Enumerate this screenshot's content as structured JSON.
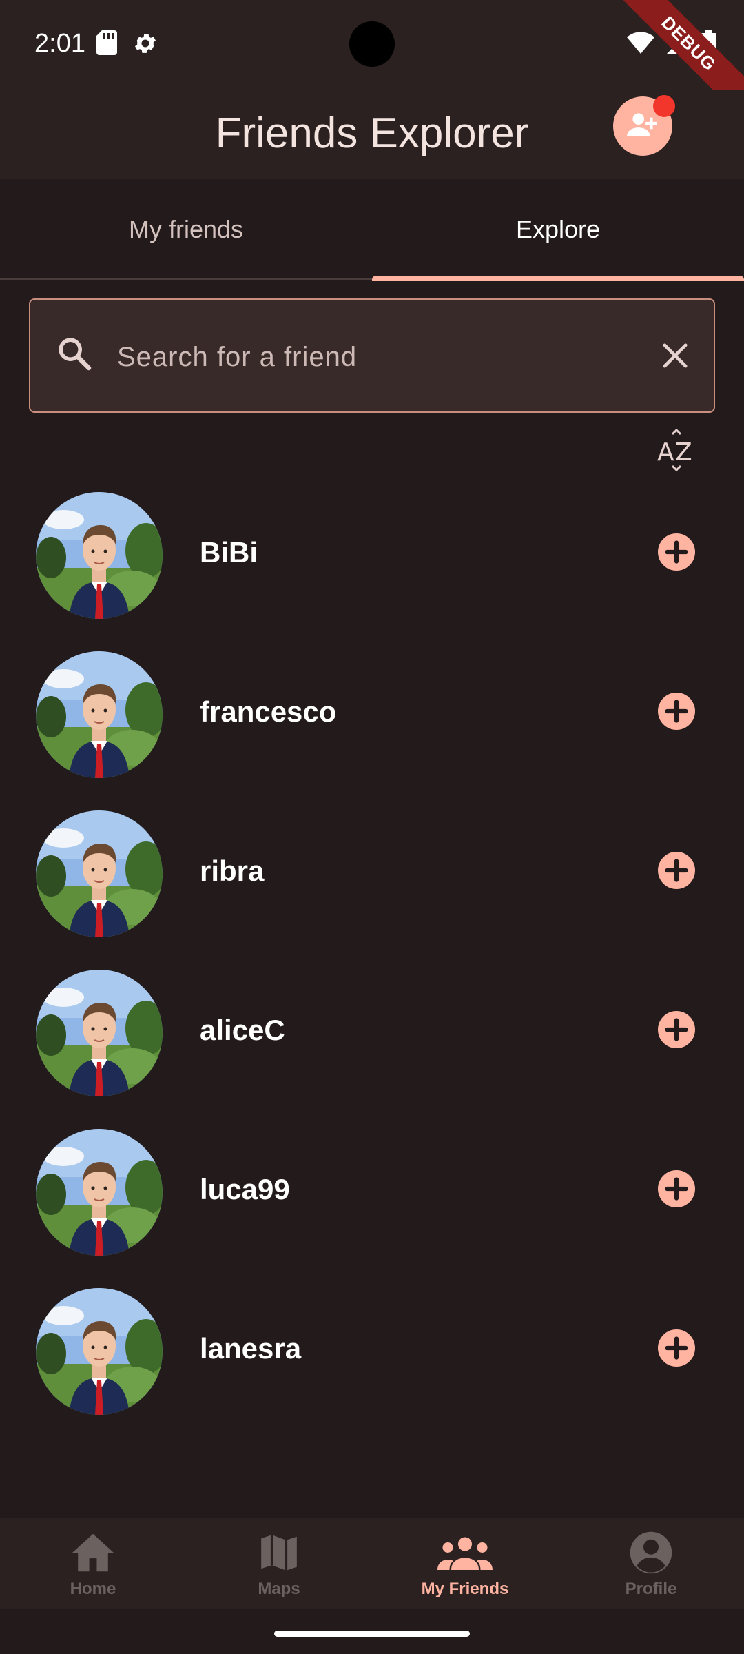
{
  "status_bar": {
    "time": "2:01",
    "debug_label": "DEBUG"
  },
  "app_bar": {
    "title": "Friends Explorer"
  },
  "tabs": [
    {
      "label": "My friends",
      "active": false
    },
    {
      "label": "Explore",
      "active": true
    }
  ],
  "search": {
    "placeholder": "Search for a friend",
    "value": ""
  },
  "friends": [
    {
      "name": "BiBi"
    },
    {
      "name": "francesco"
    },
    {
      "name": "ribra"
    },
    {
      "name": "aliceC"
    },
    {
      "name": "luca99"
    },
    {
      "name": "lanesra"
    }
  ],
  "bottom_nav": [
    {
      "label": "Home",
      "icon": "home-icon",
      "active": false
    },
    {
      "label": "Maps",
      "icon": "map-icon",
      "active": false
    },
    {
      "label": "My Friends",
      "icon": "group-icon",
      "active": true
    },
    {
      "label": "Profile",
      "icon": "account-circle-icon",
      "active": false
    }
  ],
  "colors": {
    "accent": "#ffb4a2",
    "background": "#231b1b",
    "surface": "#2b2120",
    "notification": "#f2362b"
  }
}
